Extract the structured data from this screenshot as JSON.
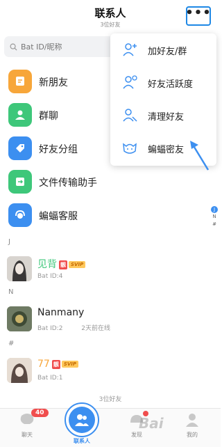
{
  "header": {
    "title": "联系人",
    "subtitle": "3位好友"
  },
  "search": {
    "placeholder": "Bat ID/昵称"
  },
  "menu": [
    {
      "label": "新朋友",
      "icon": "new-friend-icon",
      "color": "#f7a63a"
    },
    {
      "label": "群聊",
      "icon": "group-chat-icon",
      "color": "#3ec77a"
    },
    {
      "label": "好友分组",
      "icon": "tag-icon",
      "color": "#3c8ff0"
    },
    {
      "label": "文件传输助手",
      "icon": "file-transfer-icon",
      "color": "#3ec77a"
    },
    {
      "label": "蝙蝠客服",
      "icon": "customer-service-icon",
      "color": "#3c8ff0"
    }
  ],
  "sections": [
    {
      "letter": "J",
      "contact": {
        "name": "见背",
        "badge": "靓",
        "svip": "SVIP",
        "id": "Bat ID:4",
        "status": ""
      }
    },
    {
      "letter": "N",
      "contact": {
        "name": "Nanmany",
        "badge": "",
        "svip": "",
        "id": "Bat ID:2",
        "status": "2天前在线"
      }
    },
    {
      "letter": "#",
      "contact": {
        "name": "77",
        "badge": "靓",
        "svip": "SVIP",
        "id": "Bat ID:1",
        "status": ""
      }
    }
  ],
  "index_bar": [
    "J",
    "N",
    "#"
  ],
  "footer": {
    "count": "3位好友"
  },
  "tabbar": {
    "chat": {
      "label": "聊天",
      "unread": "40"
    },
    "contacts": {
      "label": "联系人"
    },
    "discover": {
      "label": "发现"
    },
    "me": {
      "label": "我的"
    }
  },
  "popup": [
    {
      "label": "加好友/群",
      "icon": "add-friend-icon"
    },
    {
      "label": "好友活跃度",
      "icon": "friend-activity-icon"
    },
    {
      "label": "清理好友",
      "icon": "clean-friends-icon"
    },
    {
      "label": "蝙蝠密友",
      "icon": "bat-close-friend-icon"
    }
  ],
  "watermark": "Bai",
  "colors": {
    "accent": "#3c8ff0",
    "red": "#f04d4d",
    "svip": "#ffc85c"
  }
}
